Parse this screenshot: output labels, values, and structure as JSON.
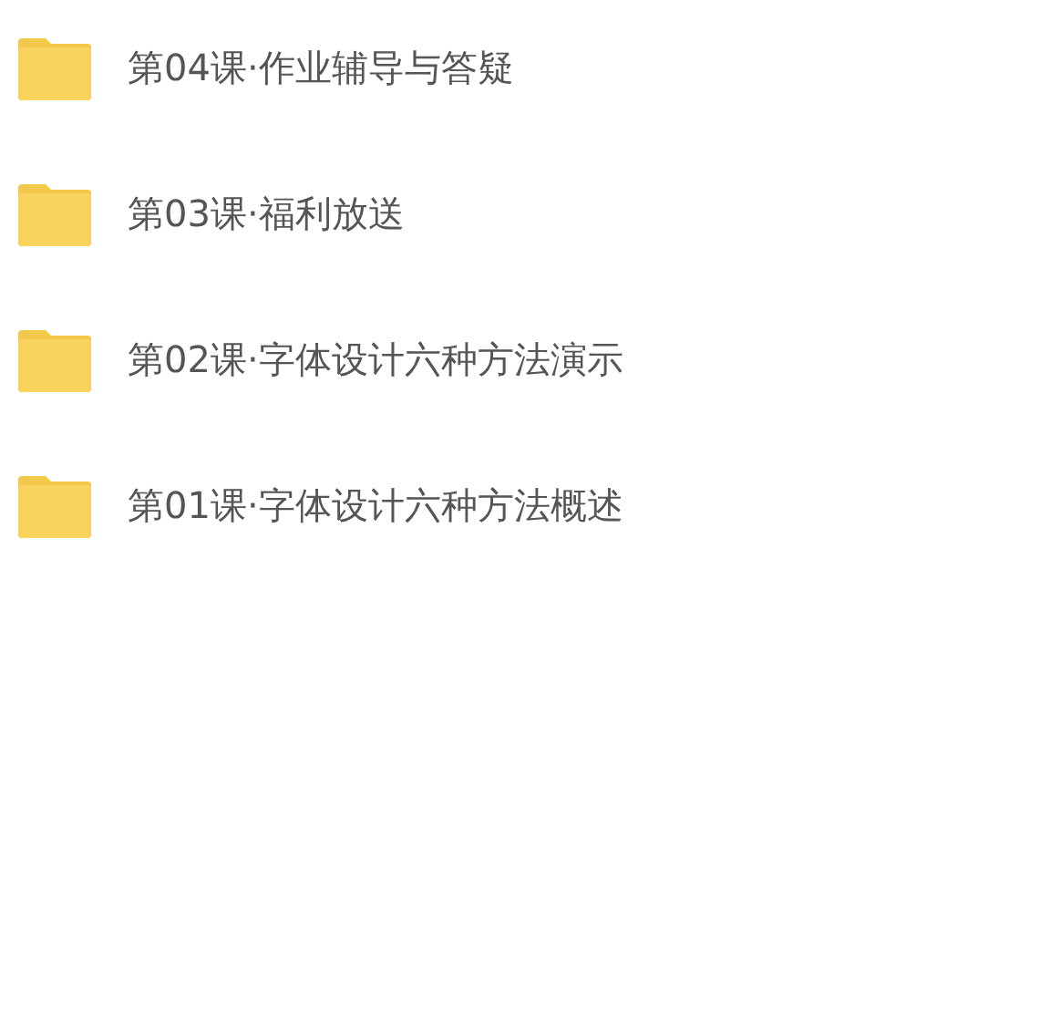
{
  "folders": [
    {
      "name": "第04课·作业辅导与答疑"
    },
    {
      "name": "第03课·福利放送"
    },
    {
      "name": "第02课·字体设计六种方法演示"
    },
    {
      "name": "第01课·字体设计六种方法概述"
    }
  ]
}
